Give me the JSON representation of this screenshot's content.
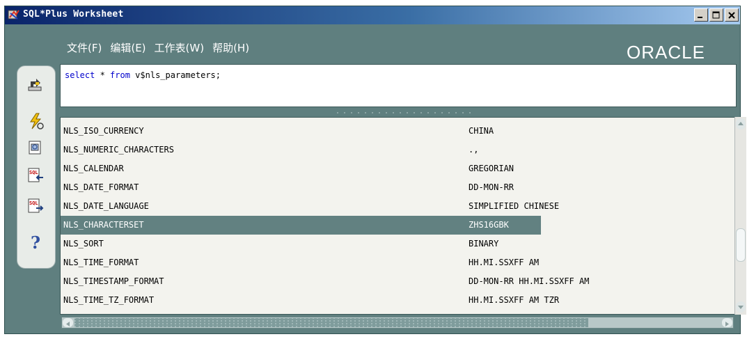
{
  "window": {
    "title": "SQL*Plus Worksheet",
    "controls": [
      "minimize",
      "maximize",
      "close"
    ]
  },
  "menu": {
    "items": [
      "文件(F)",
      "编辑(E)",
      "工作表(W)",
      "帮助(H)"
    ]
  },
  "brand": {
    "logo_text": "ORACLE"
  },
  "toolbar": {
    "icons": [
      "disconnect-icon",
      "execute-icon",
      "command-history-icon",
      "sql-import-icon",
      "sql-export-icon",
      "help-icon"
    ]
  },
  "editor": {
    "keyword_select": "select",
    "text_star": " * ",
    "keyword_from": "from",
    "text_rest": " v$nls_parameters;"
  },
  "results": {
    "selected_index": 5,
    "rows": [
      {
        "parameter": "NLS_ISO_CURRENCY",
        "value": "CHINA"
      },
      {
        "parameter": "NLS_NUMERIC_CHARACTERS",
        "value": ".,"
      },
      {
        "parameter": "NLS_CALENDAR",
        "value": "GREGORIAN"
      },
      {
        "parameter": "NLS_DATE_FORMAT",
        "value": "DD-MON-RR"
      },
      {
        "parameter": "NLS_DATE_LANGUAGE",
        "value": "SIMPLIFIED CHINESE"
      },
      {
        "parameter": "NLS_CHARACTERSET",
        "value": "ZHS16GBK"
      },
      {
        "parameter": "NLS_SORT",
        "value": "BINARY"
      },
      {
        "parameter": "NLS_TIME_FORMAT",
        "value": "HH.MI.SSXFF AM"
      },
      {
        "parameter": "NLS_TIMESTAMP_FORMAT",
        "value": "DD-MON-RR HH.MI.SSXFF AM"
      },
      {
        "parameter": "NLS_TIME_TZ_FORMAT",
        "value": "HH.MI.SSXFF AM TZR"
      }
    ]
  },
  "colors": {
    "frame": "#5f7f7f",
    "selected_row": "#628181",
    "keyword": "#0000cc"
  }
}
